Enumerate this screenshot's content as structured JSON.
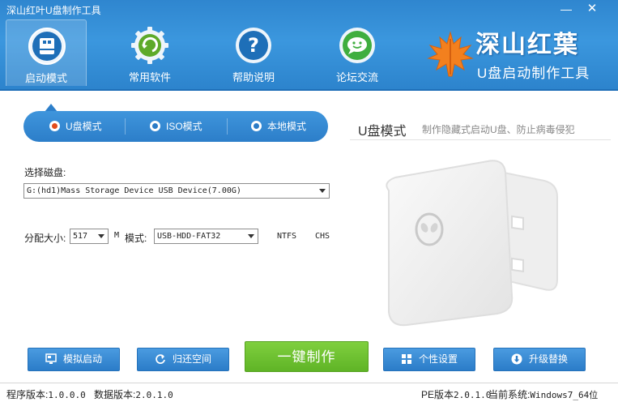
{
  "window": {
    "title": "深山红叶U盘制作工具",
    "min_glyph": "—",
    "close_glyph": "✕"
  },
  "nav": {
    "tabs": [
      {
        "label": "启动模式",
        "icon": "usb-drive-icon",
        "active": true
      },
      {
        "label": "常用软件",
        "icon": "recycle-gear-icon",
        "active": false
      },
      {
        "label": "帮助说明",
        "icon": "question-icon",
        "active": false
      },
      {
        "label": "论坛交流",
        "icon": "chat-icon",
        "active": false
      }
    ]
  },
  "brand": {
    "title": "深山红葉",
    "subtitle": "U盘启动制作工具",
    "icon": "maple-leaf-icon"
  },
  "modes": {
    "options": [
      {
        "label": "U盘模式",
        "selected": true
      },
      {
        "label": "ISO模式",
        "selected": false
      },
      {
        "label": "本地模式",
        "selected": false
      }
    ],
    "current_name": "U盘模式",
    "current_desc": "制作隐藏式启动U盘、防止病毒侵犯"
  },
  "form": {
    "disk_label": "选择磁盘:",
    "disk_value": "G:(hd1)Mass Storage Device USB Device(7.00G)",
    "alloc_label": "分配大小:",
    "alloc_value": "517",
    "alloc_unit": "M",
    "mode_label": "模式:",
    "mode_value": "USB-HDD-FAT32",
    "ntfs_label": "NTFS",
    "chs_label": "CHS"
  },
  "buttons": {
    "simulate": "模拟启动",
    "restore": "归还空间",
    "make": "一键制作",
    "customize": "个性设置",
    "upgrade": "升级替换"
  },
  "status": {
    "program_label": "程序版本:",
    "program_version": "1.0.0.0",
    "data_label": "数据版本:",
    "data_version": "2.0.1.0",
    "pe_label": "PE版本",
    "pe_version": "2.0.1.0",
    "system_label": "当前系统:",
    "system_value": "Windows7_64位"
  },
  "colors": {
    "header_blue": "#3b97de",
    "accent_blue": "#2b7cc8",
    "make_green": "#6cc12f",
    "radio_selected": "#e34b1a"
  }
}
